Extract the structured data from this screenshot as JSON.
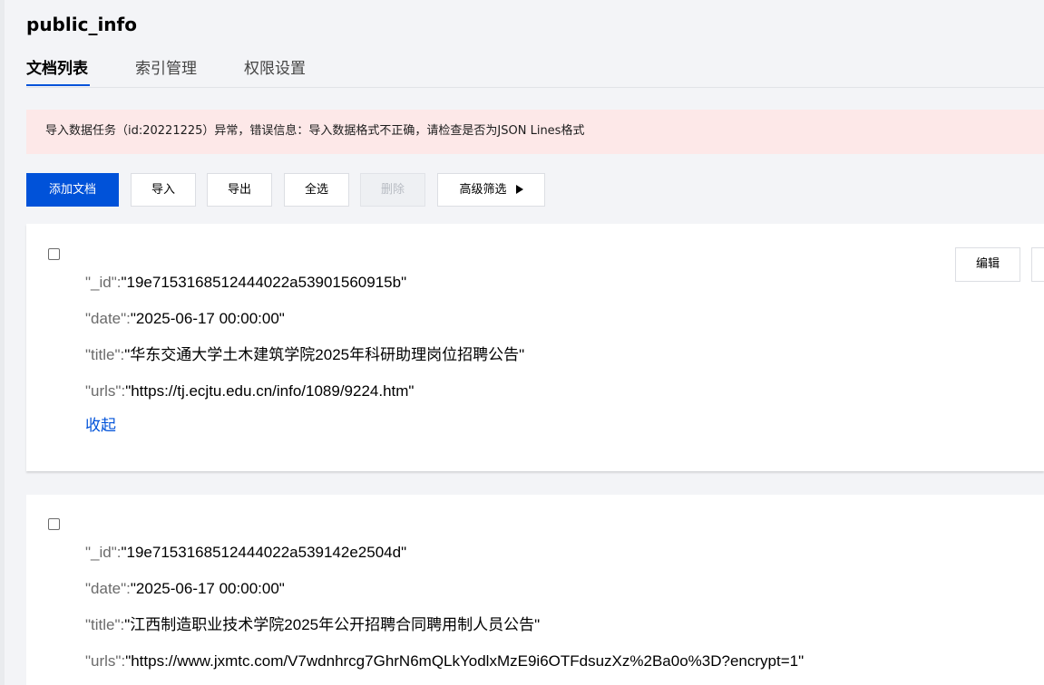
{
  "page": {
    "title": "public_info"
  },
  "tabs": [
    {
      "label": "文档列表",
      "active": true
    },
    {
      "label": "索引管理",
      "active": false
    },
    {
      "label": "权限设置",
      "active": false
    }
  ],
  "alert": {
    "message": "导入数据任务（id:20221225）异常，错误信息：导入数据格式不正确，请检查是否为JSON Lines格式"
  },
  "toolbar": {
    "add_label": "添加文档",
    "import_label": "导入",
    "export_label": "导出",
    "select_all_label": "全选",
    "delete_label": "删除",
    "filter_label": "高级筛选"
  },
  "documents": [
    {
      "fields": [
        {
          "key": "\"_id\":",
          "value": "\"19e7153168512444022a53901560915b\""
        },
        {
          "key": "\"date\":",
          "value": "\"2025-06-17 00:00:00\""
        },
        {
          "key": "\"title\":",
          "value": "\"华东交通大学土木建筑学院2025年科研助理岗位招聘公告\""
        },
        {
          "key": "\"urls\":",
          "value": "\"https://tj.ecjtu.edu.cn/info/1089/9224.htm\""
        }
      ],
      "collapse_label": "收起",
      "edit_label": "编辑"
    },
    {
      "fields": [
        {
          "key": "\"_id\":",
          "value": "\"19e7153168512444022a539142e2504d\""
        },
        {
          "key": "\"date\":",
          "value": "\"2025-06-17 00:00:00\""
        },
        {
          "key": "\"title\":",
          "value": "\"江西制造职业技术学院2025年公开招聘合同聘用制人员公告\""
        },
        {
          "key": "\"urls\":",
          "value": "\"https://www.jxmtc.com/V7wdnhrcg7GhrN6mQLkYodlxMzE9i6OTFdsuzXz%2Ba0o%3D?encrypt=1\""
        }
      ]
    }
  ],
  "colors": {
    "primary": "#0052d9",
    "alert_bg": "#fde8e8",
    "page_bg": "#f3f4f7"
  }
}
